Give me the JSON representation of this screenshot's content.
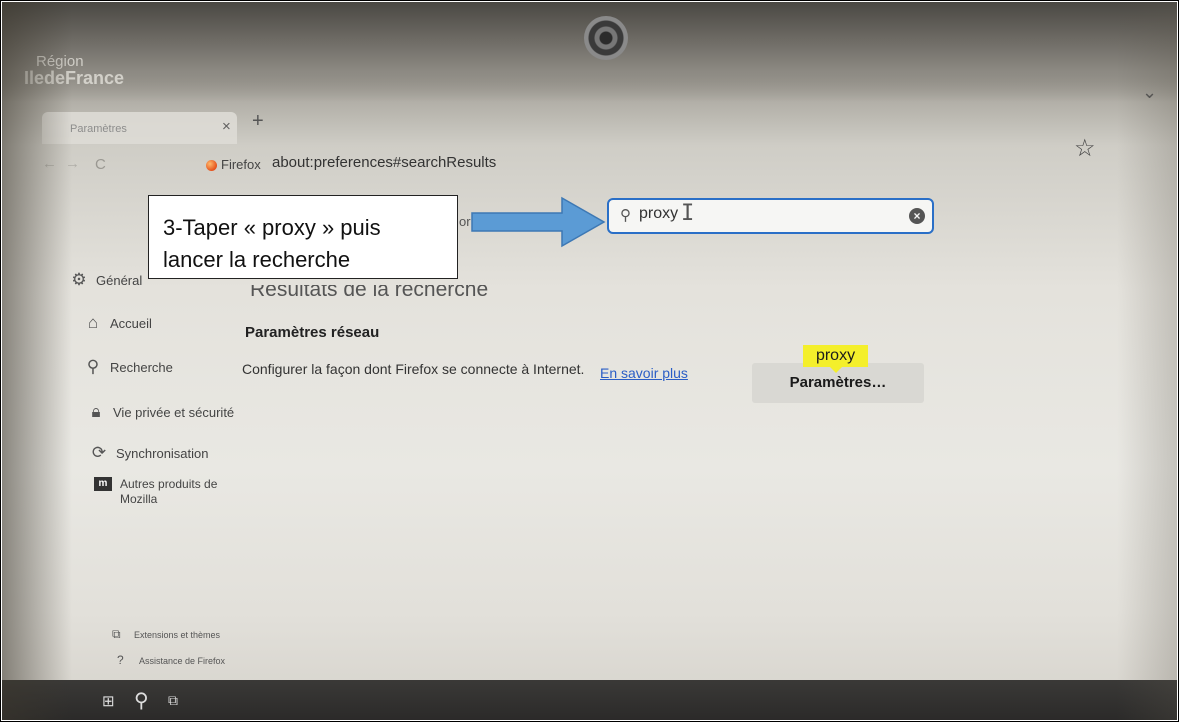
{
  "brand": {
    "line1": "Région",
    "line2": "IledeFrance"
  },
  "browser": {
    "tab_title": "Paramètres",
    "tab_close": "×",
    "new_tab": "+",
    "identity_label": "Firefox",
    "url": "about:preferences#searchResults",
    "bookmark_icon": "star-icon",
    "collapse_icon": "chevron-down-icon"
  },
  "search": {
    "value": "proxy",
    "icon": "magnifier-icon",
    "clear_icon": "clear-icon"
  },
  "callout": {
    "line1": "3-Taper « proxy » puis",
    "line2": "lancer la recherche"
  },
  "main": {
    "results_heading": "Résultats de la recherche",
    "section_title": "Paramètres réseau",
    "description": "Configurer la façon dont Firefox se connecte à Internet.",
    "learn_more": "En savoir plus",
    "highlight_tag": "proxy",
    "settings_button": "Paramètres…"
  },
  "sidebar": {
    "items": [
      {
        "label": "Général",
        "icon": "gear-icon"
      },
      {
        "label": "Accueil",
        "icon": "home-icon"
      },
      {
        "label": "Recherche",
        "icon": "search-icon"
      },
      {
        "label": "Vie privée et sécurité",
        "icon": "lock-icon"
      },
      {
        "label": "Synchronisation",
        "icon": "sync-icon"
      },
      {
        "label": "Autres produits de",
        "label2": "Mozilla",
        "icon": "mozilla-icon"
      }
    ],
    "footer": [
      {
        "label": "Extensions et thèmes",
        "icon": "puzzle-icon"
      },
      {
        "label": "Assistance de Firefox",
        "icon": "help-icon"
      }
    ]
  },
  "colors": {
    "accent": "#2a6fc7",
    "highlight": "#f4ef2b",
    "arrow": "#5b9bd5",
    "link": "#2b5ec6"
  }
}
